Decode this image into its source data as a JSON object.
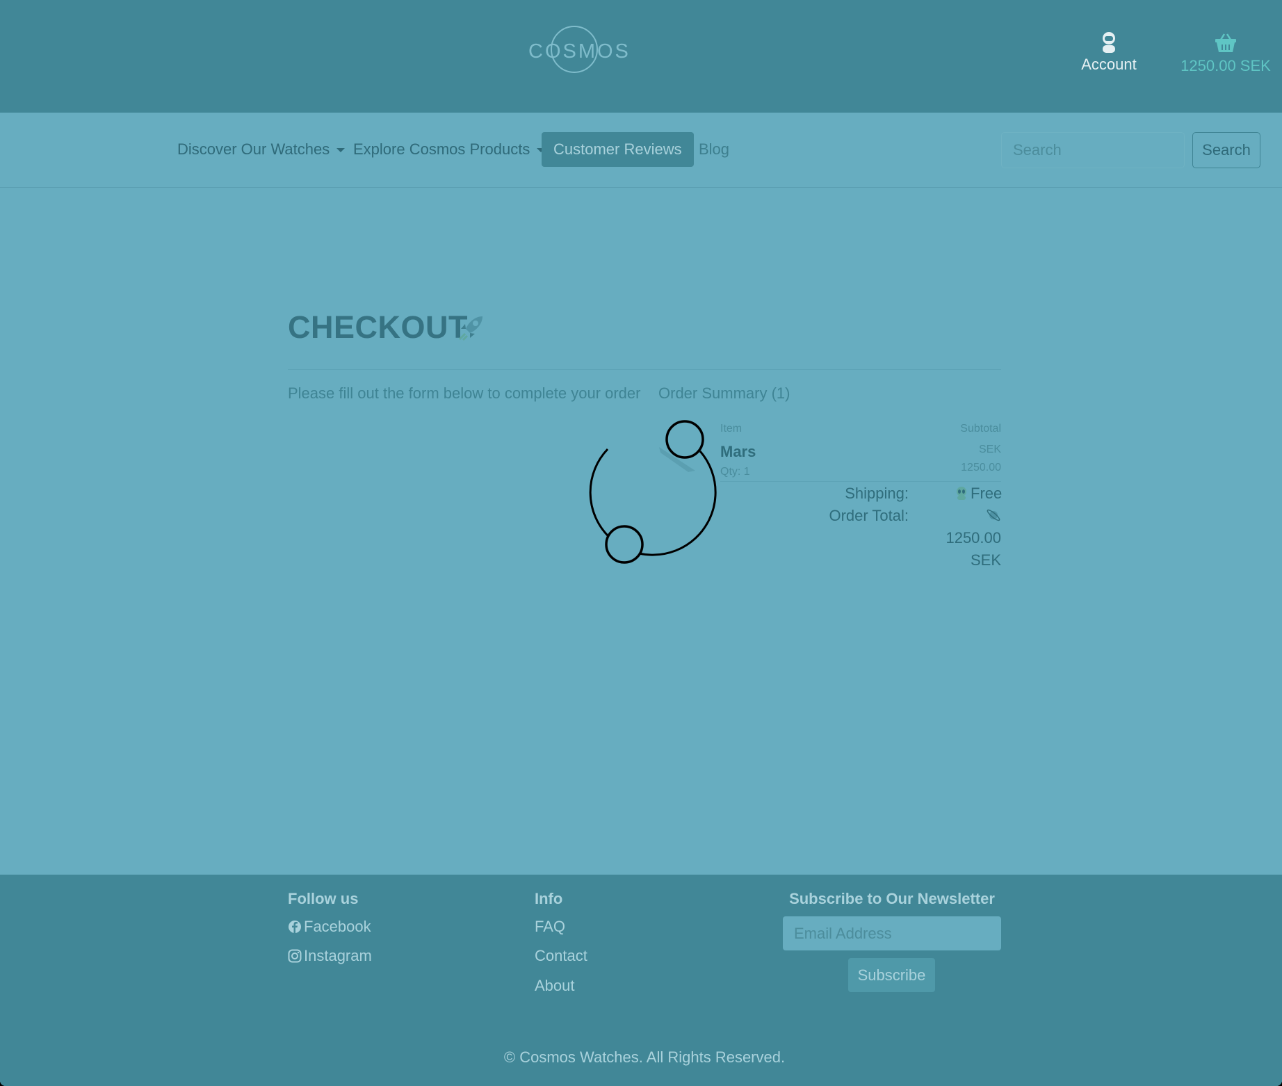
{
  "header": {
    "logo_text": "COSMOS",
    "account_label": "Account",
    "cart_total": "1250.00 SEK"
  },
  "nav": {
    "items": [
      {
        "label": "Discover Our Watches",
        "dropdown": true
      },
      {
        "label": "Explore Cosmos Products",
        "dropdown": true
      },
      {
        "label": "Customer Reviews",
        "active": true
      },
      {
        "label": "Blog"
      }
    ],
    "search_placeholder": "Search",
    "search_button": "Search"
  },
  "checkout": {
    "title": "CHECKOUT",
    "intro": "Please fill out the form below to complete your order",
    "summary_title": "Order Summary (1)",
    "col_item": "Item",
    "col_subtotal": "Subtotal",
    "product": {
      "name": "Mars",
      "qty": "Qty: 1",
      "subtotal_currency": "SEK",
      "subtotal_value": "1250.00"
    },
    "shipping_label": "Shipping:",
    "shipping_value": "Free",
    "total_label": "Order Total:",
    "total_value": "1250.00",
    "total_currency": "SEK"
  },
  "footer": {
    "follow_heading": "Follow us",
    "social": [
      "Facebook",
      "Instagram"
    ],
    "info_heading": "Info",
    "info_links": [
      "FAQ",
      "Contact",
      "About"
    ],
    "newsletter_heading": "Subscribe to Our Newsletter",
    "email_placeholder": "Email Address",
    "subscribe_button": "Subscribe",
    "copyright": "© Cosmos Watches. All Rights Reserved."
  },
  "colors": {
    "header_bg": "#418797",
    "page_bg": "#67adc0",
    "active_nav_bg": "#418797",
    "cart_accent": "#5fc5c4"
  },
  "icons": [
    "logo-orbit-icon",
    "astronaut-icon",
    "basket-icon",
    "caret-down-icon",
    "rocket-icon",
    "alien-icon",
    "planet-icon",
    "facebook-icon",
    "instagram-icon",
    "loading-spinner-icon"
  ]
}
